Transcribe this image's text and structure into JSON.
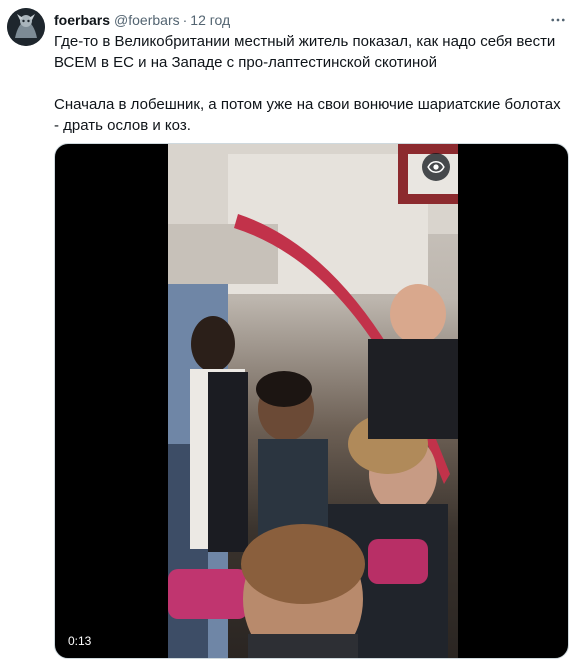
{
  "tweet": {
    "author": {
      "display_name": "foerbars",
      "handle": "@foerbars",
      "separator": "·",
      "time": "12 год",
      "avatar_icon": "avatar-image"
    },
    "more_icon": "more-horizontal-icon",
    "text": {
      "paragraph1": "Где-то в Великобритании местный житель показал, как надо себя вести ВСЕМ в ЕС и на Западе с про-лаптестинской скотиной",
      "paragraph2": "Сначала в лобешник, а потом уже на свои вонючие шариатские болотах - драть ослов и коз."
    },
    "media": {
      "type": "video",
      "duration": "0:13",
      "overlay_icon": "eye-icon"
    }
  },
  "colors": {
    "text": "#0f1419",
    "secondary_text": "#536471",
    "media_border": "#cfd9de",
    "background": "#ffffff"
  }
}
